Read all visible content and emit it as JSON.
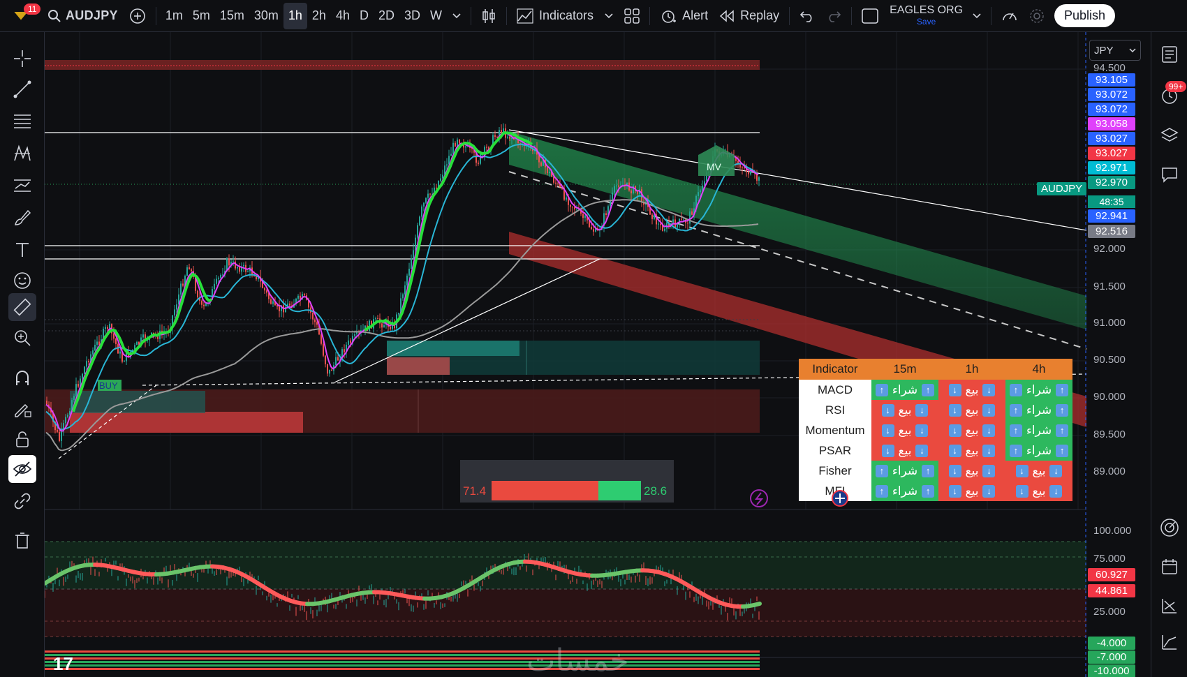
{
  "toolbar": {
    "notification_count": "11",
    "symbol": "AUDJPY",
    "timeframes": [
      "1m",
      "5m",
      "15m",
      "30m",
      "1h",
      "2h",
      "4h",
      "D",
      "2D",
      "3D",
      "W"
    ],
    "active_timeframe": "1h",
    "indicators_label": "Indicators",
    "alert_label": "Alert",
    "replay_label": "Replay",
    "account_name": "EAGLES ORG",
    "account_save": "Save",
    "publish_label": "Publish"
  },
  "right_toolbar": {
    "notifications_badge": "99+"
  },
  "price_scale": {
    "currency": "JPY",
    "labels": [
      "94.500",
      "92.000",
      "91.500",
      "91.000",
      "90.500",
      "90.000",
      "89.500",
      "89.000"
    ],
    "badges": [
      {
        "value": "93.105",
        "color": "#2962ff"
      },
      {
        "value": "93.072",
        "color": "#2962ff"
      },
      {
        "value": "93.072",
        "color": "#2962ff"
      },
      {
        "value": "93.058",
        "color": "#e040fb"
      },
      {
        "value": "93.027",
        "color": "#2962ff"
      },
      {
        "value": "93.027",
        "color": "#f23645"
      },
      {
        "value": "92.971",
        "color": "#00bcd4"
      },
      {
        "value": "92.970",
        "color": "#089981"
      },
      {
        "value": "92.941",
        "color": "#2962ff"
      },
      {
        "value": "92.516",
        "color": "#787b86"
      }
    ],
    "symbol_tag": "AUDJPY",
    "countdown": "48:35"
  },
  "oscillator_scale": {
    "labels": [
      "100.000",
      "75.000",
      "25.000"
    ],
    "badges": [
      {
        "value": "60.927",
        "color": "#f23645"
      },
      {
        "value": "44.861",
        "color": "#f23645"
      }
    ]
  },
  "bottom_scale": {
    "badges": [
      {
        "value": "-4.000",
        "color": "#26a65b"
      },
      {
        "value": "-7.000",
        "color": "#26a65b"
      },
      {
        "value": "-10.000",
        "color": "#26a65b"
      }
    ]
  },
  "chart_labels": {
    "buy": "BUY",
    "mv": "MV"
  },
  "indicator_table": {
    "headers": [
      "Indicator",
      "15m",
      "1h",
      "4h"
    ],
    "rows": [
      {
        "name": "MACD",
        "cells": [
          {
            "signal": "شراء",
            "type": "buy"
          },
          {
            "signal": "بيع",
            "type": "sell"
          },
          {
            "signal": "شراء",
            "type": "buy"
          }
        ]
      },
      {
        "name": "RSI",
        "cells": [
          {
            "signal": "بيع",
            "type": "sell"
          },
          {
            "signal": "بيع",
            "type": "sell"
          },
          {
            "signal": "شراء",
            "type": "buy"
          }
        ]
      },
      {
        "name": "Momentum",
        "cells": [
          {
            "signal": "بيع",
            "type": "sell"
          },
          {
            "signal": "بيع",
            "type": "sell"
          },
          {
            "signal": "شراء",
            "type": "buy"
          }
        ]
      },
      {
        "name": "PSAR",
        "cells": [
          {
            "signal": "بيع",
            "type": "sell"
          },
          {
            "signal": "بيع",
            "type": "sell"
          },
          {
            "signal": "شراء",
            "type": "buy"
          }
        ]
      },
      {
        "name": "Fisher",
        "cells": [
          {
            "signal": "شراء",
            "type": "buy"
          },
          {
            "signal": "بيع",
            "type": "sell"
          },
          {
            "signal": "بيع",
            "type": "sell"
          }
        ]
      },
      {
        "name": "MFI",
        "cells": [
          {
            "signal": "شراء",
            "type": "buy"
          },
          {
            "signal": "بيع",
            "type": "sell"
          },
          {
            "signal": "بيع",
            "type": "sell"
          }
        ]
      }
    ]
  },
  "sentiment": {
    "sell_value": "71.4",
    "buy_value": "28.6",
    "sell_fraction": 0.714
  },
  "watermark": "خمسات"
}
